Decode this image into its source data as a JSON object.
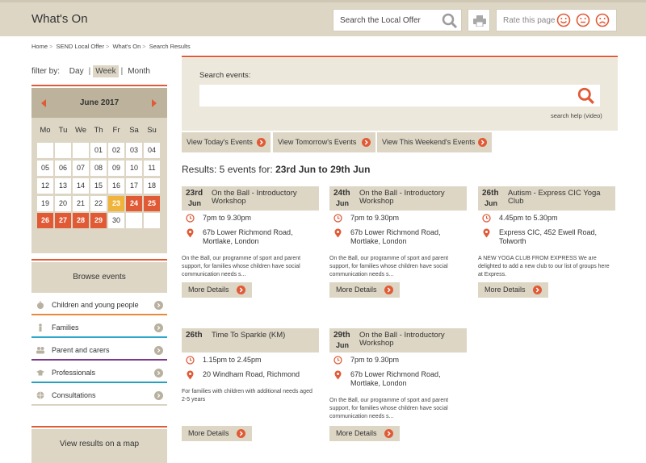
{
  "header": {
    "title": "What's On",
    "search_placeholder": "Search the Local Offer",
    "rate_label": "Rate this page"
  },
  "breadcrumb": [
    "Home",
    "SEND Local Offer",
    "What's On",
    "Search Results"
  ],
  "filter": {
    "label": "filter by:",
    "options": [
      "Day",
      "Week",
      "Month"
    ],
    "active": "Week"
  },
  "calendar": {
    "month": "June 2017",
    "weekdays": [
      "Mo",
      "Tu",
      "We",
      "Th",
      "Fr",
      "Sa",
      "Su"
    ],
    "weeks": [
      [
        "",
        "",
        "",
        "01",
        "02",
        "03",
        "04"
      ],
      [
        "05",
        "06",
        "07",
        "08",
        "09",
        "10",
        "11"
      ],
      [
        "12",
        "13",
        "14",
        "15",
        "16",
        "17",
        "18"
      ],
      [
        "19",
        "20",
        "21",
        "22",
        "23",
        "24",
        "25"
      ],
      [
        "26",
        "27",
        "28",
        "29",
        "30",
        "",
        ""
      ]
    ],
    "today": "23",
    "event_days": [
      "24",
      "25",
      "26",
      "27",
      "28",
      "29"
    ],
    "colors": {
      "event": "#e15a36",
      "today": "#f0b43c"
    }
  },
  "browse": {
    "title": "Browse events",
    "items": [
      {
        "label": "Children and young people",
        "icon": "apple-icon",
        "color": "#e98a3a"
      },
      {
        "label": "Families",
        "icon": "person-icon",
        "color": "#2aa7c9"
      },
      {
        "label": "Parent and carers",
        "icon": "group-icon",
        "color": "#7b3a8a"
      },
      {
        "label": "Professionals",
        "icon": "hat-icon",
        "color": "#2a9fbf"
      },
      {
        "label": "Consultations",
        "icon": "globe-icon",
        "color": "#d9d3c4"
      }
    ]
  },
  "map_label": "View results on a map",
  "search": {
    "label": "Search events:",
    "value": "",
    "help": "search help (video)"
  },
  "quick_links": [
    "View Today's Events",
    "View Tomorrow's Events",
    "View This Weekend's Events"
  ],
  "results": {
    "prefix": "Results: 5 events for: ",
    "range": "23rd Jun to 29th Jun"
  },
  "events": [
    {
      "day": "23rd",
      "month": "Jun",
      "title": "On the Ball - Introductory Workshop",
      "time": "7pm to 9.30pm",
      "address": "67b Lower Richmond Road, Mortlake, London",
      "desc": "On the Ball, our programme of sport and parent support, for families whose children have social communication needs s...",
      "more": "More Details"
    },
    {
      "day": "24th",
      "month": "Jun",
      "title": "On the Ball - Introductory Workshop",
      "time": "7pm to 9.30pm",
      "address": "67b Lower Richmond Road, Mortlake, London",
      "desc": "On the Ball, our programme of sport and parent support, for families whose children have social communication needs s...",
      "more": "More Details"
    },
    {
      "day": "26th",
      "month": "Jun",
      "title": "Autism - Express CIC Yoga Club",
      "time": "4.45pm to 5.30pm",
      "address": "Express CIC, 452 Ewell Road, Tolworth",
      "desc": "A NEW YOGA CLUB FROM EXPRESS We are delighted to add a new club to our list of groups here at Express.",
      "more": "More Details"
    },
    {
      "day": "26th",
      "month": "",
      "title": "Time To Sparkle (KM)",
      "time": "1.15pm to 2.45pm",
      "address": "20 Windham Road, Richmond",
      "desc": "For families with children with additional needs aged 2-5 years",
      "more": "More Details"
    },
    {
      "day": "29th",
      "month": "Jun",
      "title": "On the Ball - Introductory Workshop",
      "time": "7pm to 9.30pm",
      "address": "67b Lower Richmond Road, Mortlake, London",
      "desc": "On the Ball, our programme of sport and parent support, for families whose children have social communication needs s...",
      "more": "More Details"
    }
  ]
}
